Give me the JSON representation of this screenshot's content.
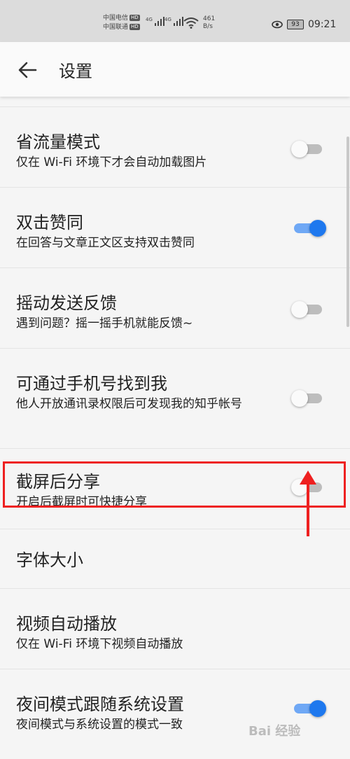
{
  "status_bar": {
    "carrier_1": "中国电信",
    "carrier_2": "中国联通",
    "hd_label": "HD",
    "net_1": "4G",
    "net_2": "4G",
    "speed_value": "461",
    "speed_unit": "B/s",
    "battery": "93",
    "time": "09:21"
  },
  "app_bar": {
    "title": "设置"
  },
  "settings": [
    {
      "title": "省流量模式",
      "subtitle": "仅在 Wi-Fi 环境下才会自动加载图片",
      "toggle": "off"
    },
    {
      "title": "双击赞同",
      "subtitle": "在回答与文章正文区支持双击赞同",
      "toggle": "on"
    },
    {
      "title": "摇动发送反馈",
      "subtitle": "遇到问题？摇一摇手机就能反馈~",
      "toggle": "off"
    },
    {
      "title": "可通过手机号找到我",
      "subtitle": "他人开放通讯录权限后可发现我的知乎帐号",
      "toggle": "off"
    },
    {
      "title": "截屏后分享",
      "subtitle": "开启后截屏时可快捷分享",
      "toggle": "off"
    },
    {
      "title": "字体大小",
      "subtitle": "",
      "toggle": "none"
    },
    {
      "title": "视频自动播放",
      "subtitle": "仅在 Wi-Fi 环境下视频自动播放",
      "toggle": "none"
    },
    {
      "title": "夜间模式跟随系统设置",
      "subtitle": "夜间模式与系统设置的模式一致",
      "toggle": "on"
    }
  ],
  "watermark": "Bai 经验",
  "colors": {
    "accent_blue": "#1e78ee",
    "highlight_red": "#ee2020",
    "background": "#f5f5f5"
  }
}
